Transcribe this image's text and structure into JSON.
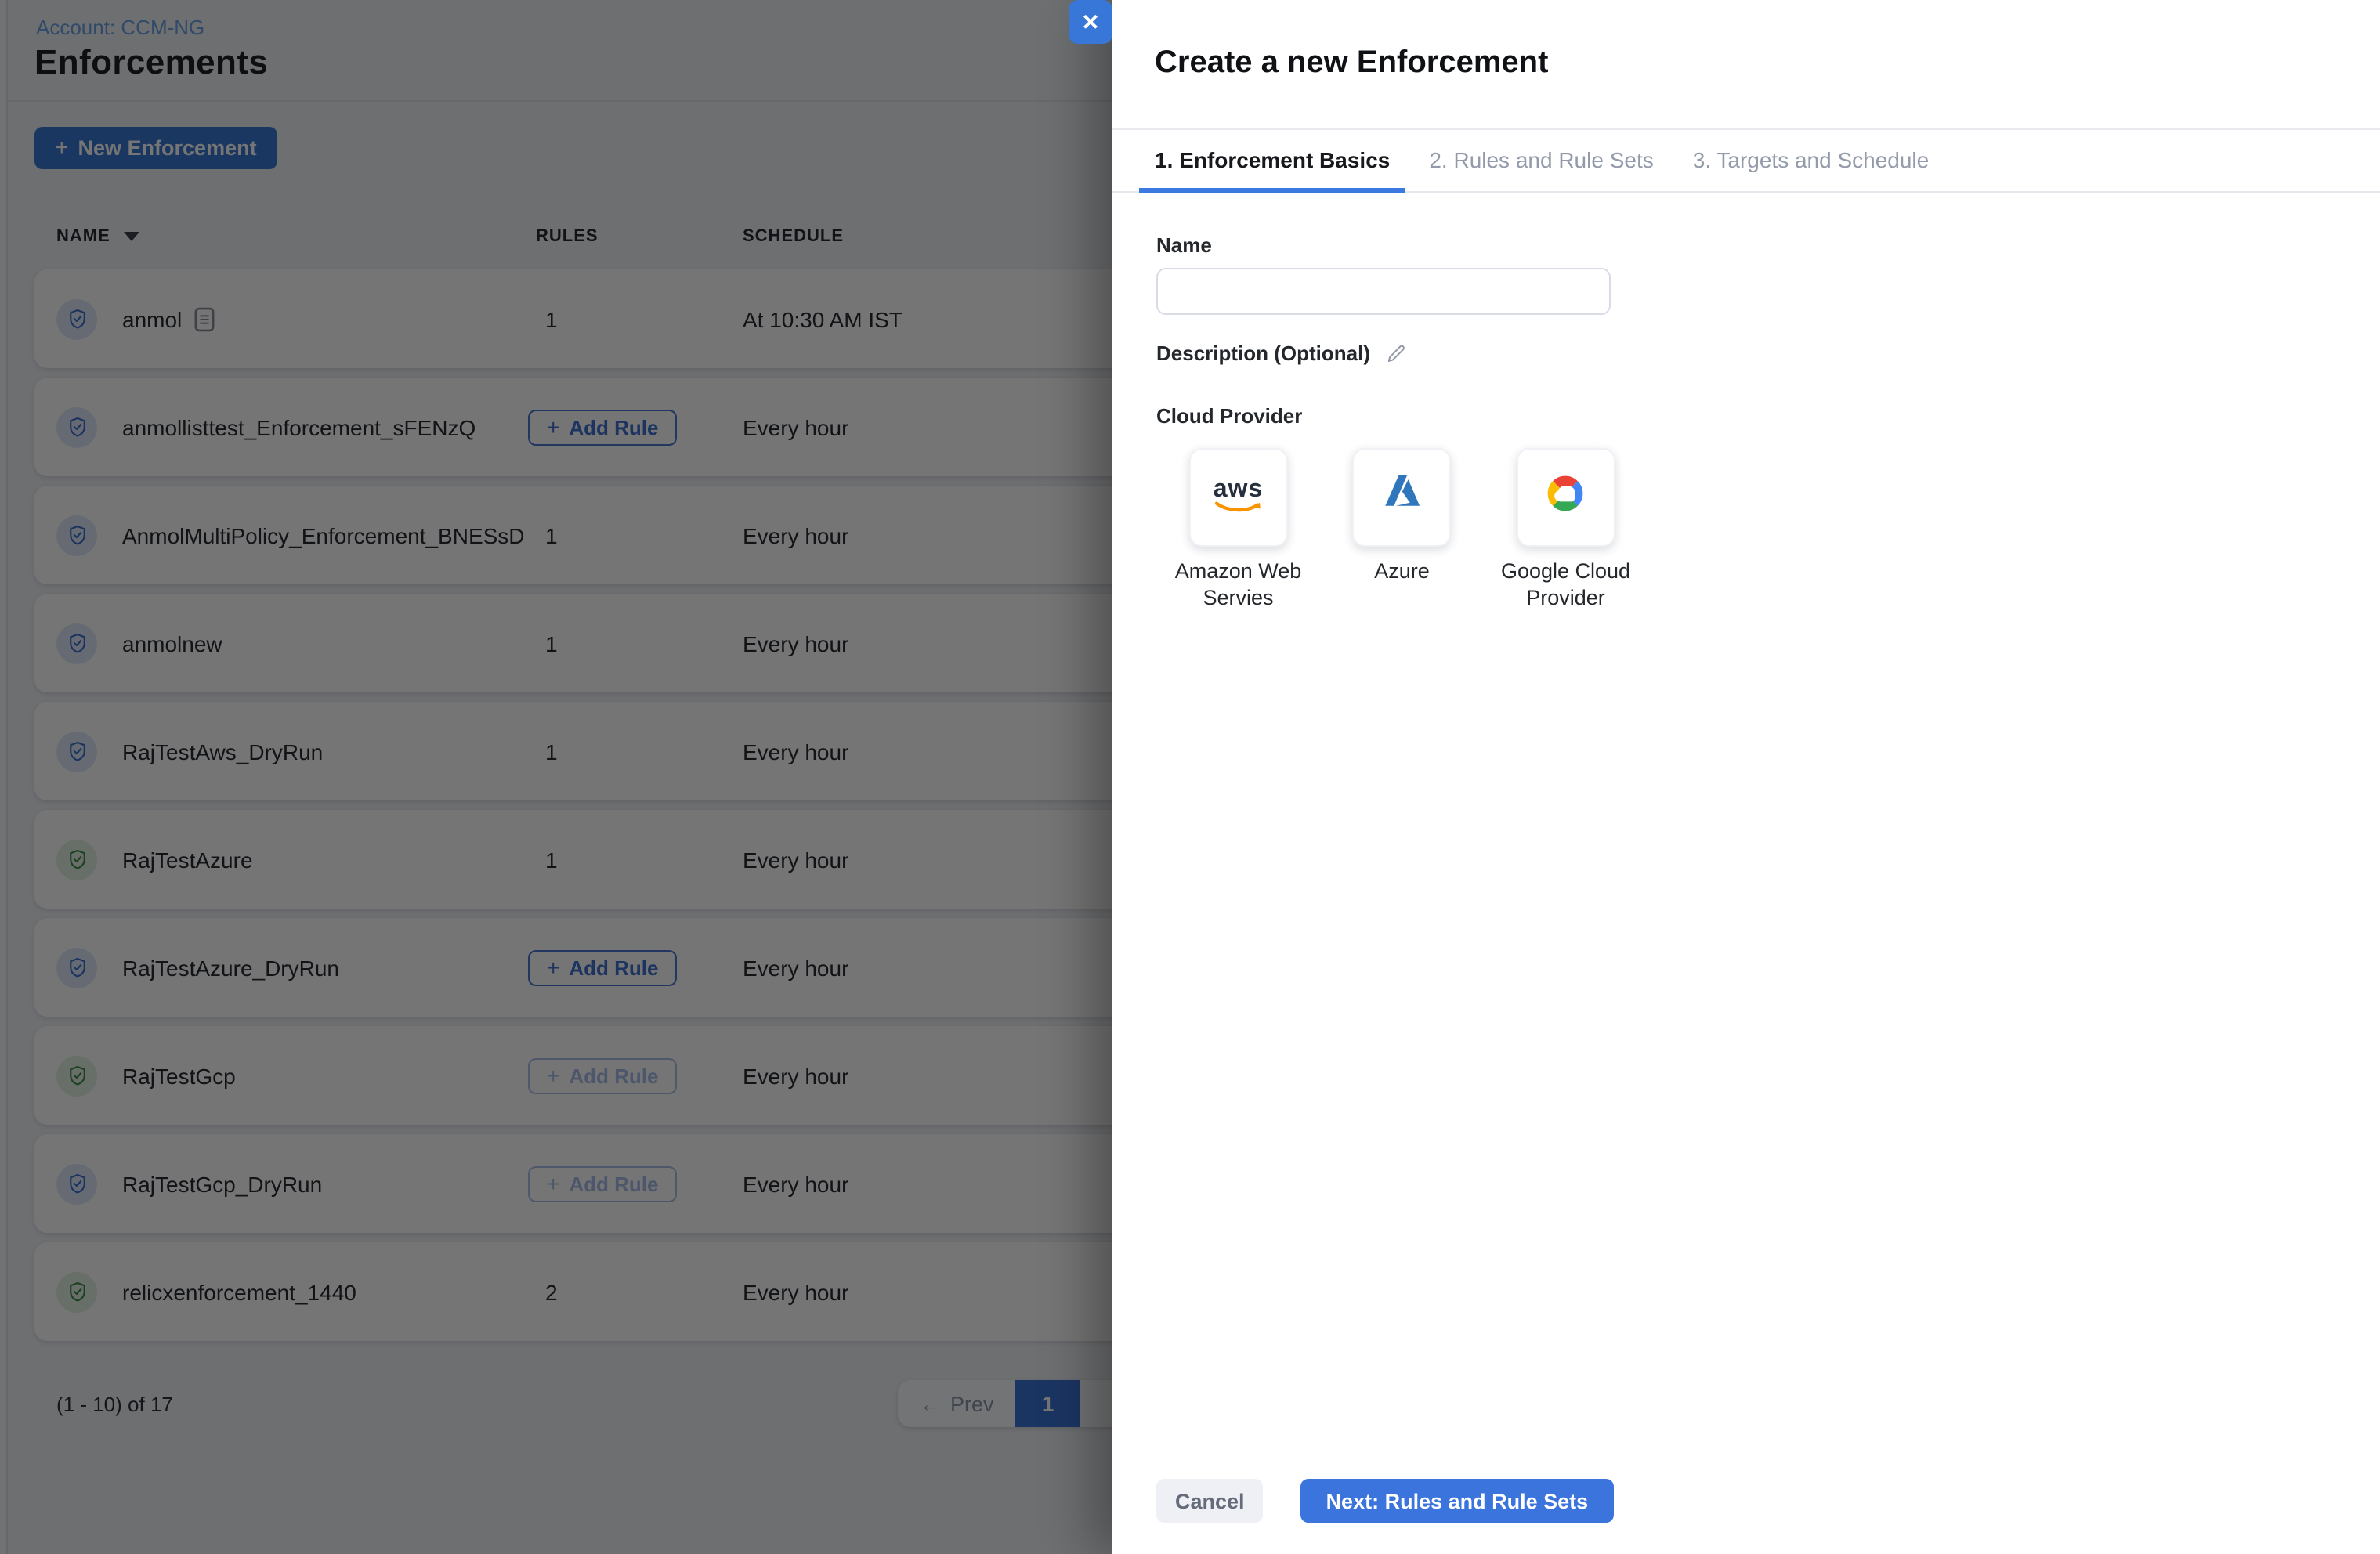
{
  "page": {
    "breadcrumb": "Account: CCM-NG",
    "title": "Enforcements",
    "new_enforcement_label": "New Enforcement"
  },
  "icons": {
    "plus": "+",
    "close": "✕",
    "arrow_left": "←"
  },
  "table": {
    "columns": {
      "name": "NAME",
      "rules": "RULES",
      "schedule": "SCHEDULE"
    },
    "add_rule_label": "Add Rule",
    "rows": [
      {
        "name": "anmol",
        "icon": "blue",
        "has_doc_icon": true,
        "rules": "1",
        "rules_button": false,
        "add_rule_disabled": false,
        "schedule": "At 10:30 AM IST"
      },
      {
        "name": "anmollisttest_Enforcement_sFENzQ",
        "icon": "blue",
        "has_doc_icon": false,
        "rules": "",
        "rules_button": true,
        "add_rule_disabled": false,
        "schedule": "Every hour"
      },
      {
        "name": "AnmolMultiPolicy_Enforcement_BNESsD",
        "icon": "blue",
        "has_doc_icon": false,
        "rules": "1",
        "rules_button": false,
        "add_rule_disabled": false,
        "schedule": "Every hour"
      },
      {
        "name": "anmolnew",
        "icon": "blue",
        "has_doc_icon": false,
        "rules": "1",
        "rules_button": false,
        "add_rule_disabled": false,
        "schedule": "Every hour"
      },
      {
        "name": "RajTestAws_DryRun",
        "icon": "blue",
        "has_doc_icon": false,
        "rules": "1",
        "rules_button": false,
        "add_rule_disabled": false,
        "schedule": "Every hour"
      },
      {
        "name": "RajTestAzure",
        "icon": "green",
        "has_doc_icon": false,
        "rules": "1",
        "rules_button": false,
        "add_rule_disabled": false,
        "schedule": "Every hour"
      },
      {
        "name": "RajTestAzure_DryRun",
        "icon": "blue",
        "has_doc_icon": false,
        "rules": "",
        "rules_button": true,
        "add_rule_disabled": false,
        "schedule": "Every hour"
      },
      {
        "name": "RajTestGcp",
        "icon": "green",
        "has_doc_icon": false,
        "rules": "",
        "rules_button": true,
        "add_rule_disabled": true,
        "schedule": "Every hour"
      },
      {
        "name": "RajTestGcp_DryRun",
        "icon": "blue",
        "has_doc_icon": false,
        "rules": "",
        "rules_button": true,
        "add_rule_disabled": true,
        "schedule": "Every hour"
      },
      {
        "name": "relicxenforcement_1440",
        "icon": "green",
        "has_doc_icon": false,
        "rules": "2",
        "rules_button": false,
        "add_rule_disabled": false,
        "schedule": "Every hour"
      }
    ]
  },
  "pagination": {
    "range": "(1 - 10) of 17",
    "prev_label": "Prev",
    "current_page": "1"
  },
  "drawer": {
    "title": "Create a new Enforcement",
    "tabs": [
      {
        "label": "1. Enforcement Basics",
        "active": true
      },
      {
        "label": "2. Rules and Rule Sets",
        "active": false
      },
      {
        "label": "3. Targets and Schedule",
        "active": false
      }
    ],
    "name_label": "Name",
    "name_value": "",
    "description_label": "Description (Optional)",
    "cloud_provider_label": "Cloud Provider",
    "providers": [
      {
        "name": "Amazon Web Servies",
        "icon": "aws"
      },
      {
        "name": "Azure",
        "icon": "azure"
      },
      {
        "name": "Google Cloud Provider",
        "icon": "gcp"
      }
    ],
    "cancel_label": "Cancel",
    "next_label": "Next: Rules and Rule Sets"
  },
  "colors": {
    "primary_blue": "#3b74dc",
    "link_blue": "#6ba1e8",
    "shield_blue": "#3f6fd0",
    "shield_green": "#3f8f4a",
    "aws_orange": "#f79400",
    "aws_navy": "#252f3e",
    "azure_blue": "#3076bc",
    "gcp_red": "#ea4335",
    "gcp_blue": "#4285f4",
    "gcp_yellow": "#fbbc05",
    "gcp_green": "#34a853",
    "overlay": "rgba(0,0,0,0.54)"
  }
}
